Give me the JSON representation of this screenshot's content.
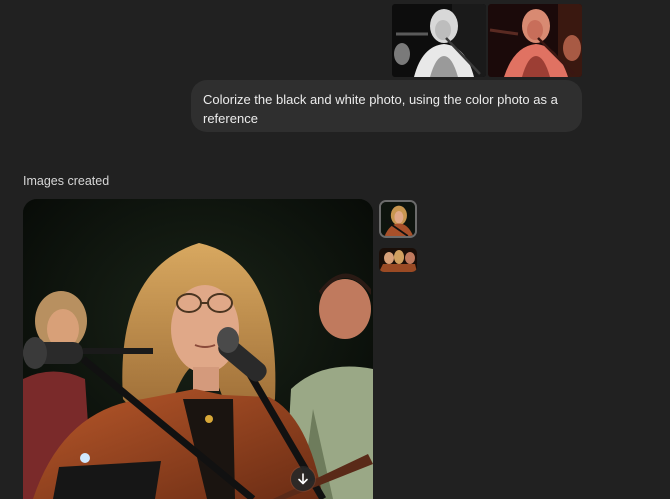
{
  "user_message": {
    "text": "Colorize the black and white photo, using the color photo as a reference",
    "attachments": [
      {
        "icon": "black-and-white-photo"
      },
      {
        "icon": "color-photo"
      }
    ]
  },
  "response": {
    "section_label": "Images created",
    "download_icon": "arrow-down-icon",
    "thumbnails": [
      {
        "icon": "generated-image-thumbnail",
        "selected": true
      },
      {
        "icon": "generated-image-thumbnail",
        "selected": false
      }
    ]
  },
  "colors": {
    "background": "#212121",
    "bubble": "#2f2f2f",
    "text": "#ececec"
  }
}
